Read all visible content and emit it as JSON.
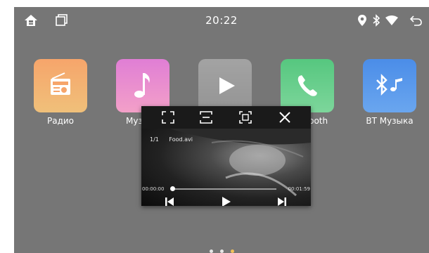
{
  "status_bar": {
    "time": "20:22",
    "left_icons": [
      "home-icon",
      "recent-apps-icon"
    ],
    "right_icons": [
      "location-icon",
      "bluetooth-icon",
      "wifi-icon",
      "back-icon"
    ]
  },
  "apps": [
    {
      "label": "Радио",
      "icon": "radio-icon",
      "color": "#f6a56b"
    },
    {
      "label": "Музыка",
      "icon": "music-note-icon",
      "color": "#e07ed5"
    },
    {
      "label": "",
      "icon": "play-icon",
      "color": "#9c9c9c"
    },
    {
      "label": "Bluetooth",
      "icon": "phone-icon",
      "color": "#56c77f"
    },
    {
      "label": "BT Музыка",
      "icon": "bluetooth-music-icon",
      "color": "#4b8de8"
    }
  ],
  "video_popup": {
    "toolbar_icons": [
      "fullscreen-icon",
      "fit-screen-icon",
      "stretch-screen-icon",
      "close-icon"
    ],
    "track_index": "1/1",
    "file_name": "Food.avi",
    "elapsed": "00:00:00",
    "duration": "00:01:59",
    "progress": 0.0
  },
  "pager": {
    "pages": 3,
    "active_page": 3
  }
}
